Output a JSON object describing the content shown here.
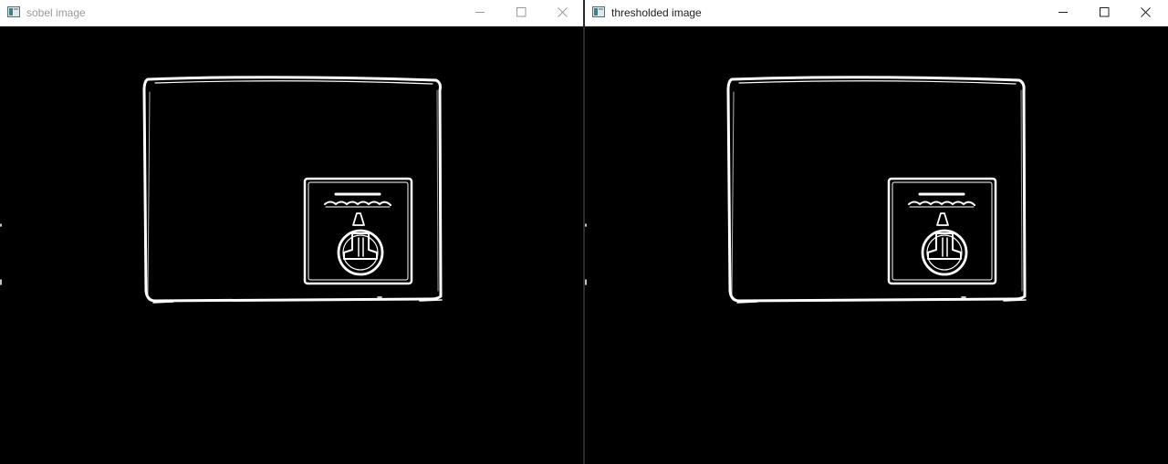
{
  "windows": [
    {
      "title": "sobel image",
      "active": false,
      "controls": [
        "minimize-icon",
        "maximize-icon",
        "close-icon"
      ]
    },
    {
      "title": "thresholded image",
      "active": true,
      "controls": [
        "minimize-icon",
        "maximize-icon",
        "close-icon"
      ]
    }
  ],
  "colors": {
    "titlebar_bg": "#ffffff",
    "title_inactive": "#9a9a9a",
    "title_active": "#202020",
    "canvas_bg": "#000000",
    "edge_color": "#ffffff"
  },
  "image_content": "white edge outlines of a box with a square label containing a light-bulb logo"
}
